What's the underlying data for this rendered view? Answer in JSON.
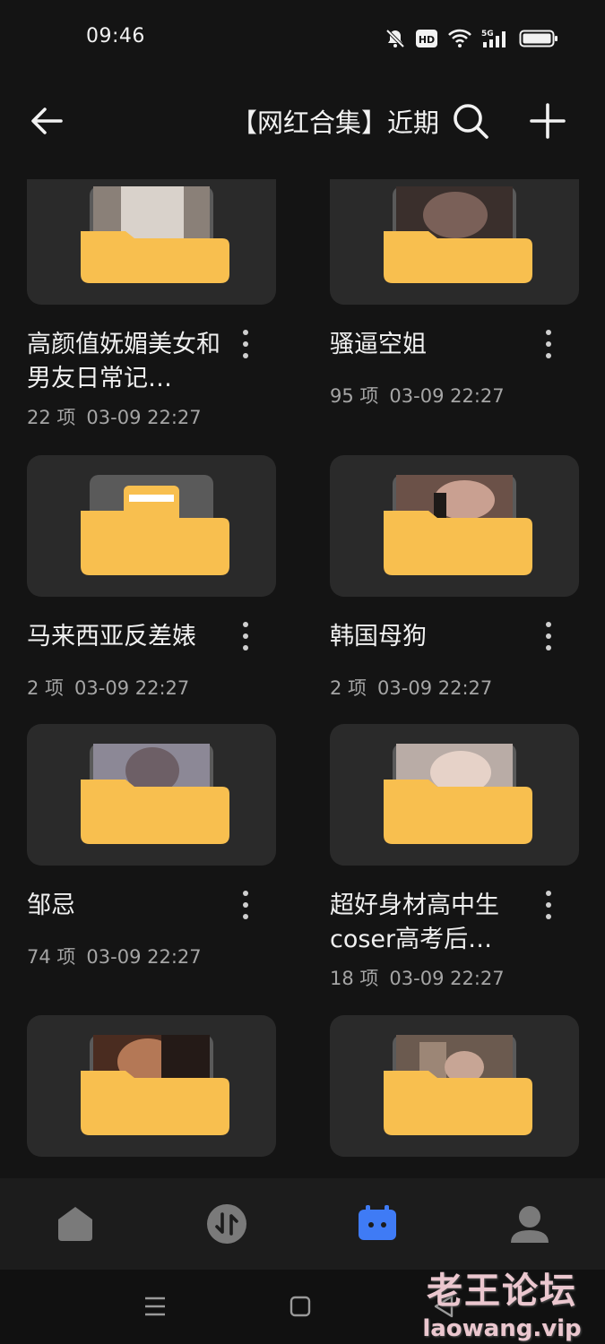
{
  "status_bar": {
    "time": "09:46",
    "icons": [
      "mute-icon",
      "hd-icon",
      "wifi-icon",
      "5g-signal-icon",
      "battery-icon"
    ],
    "hd_label": "HD",
    "network_label": "5G"
  },
  "app_bar": {
    "title": "【网红合集】近期"
  },
  "folders": [
    {
      "name": "高颜值妩媚美女和男友日常记…",
      "count": "22 项",
      "date": "03-09 22:27",
      "preview": "photo"
    },
    {
      "name": "骚逼空姐",
      "count": "95 项",
      "date": "03-09 22:27",
      "preview": "photo"
    },
    {
      "name": "马来西亚反差婊",
      "count": "2 项",
      "date": "03-09 22:27",
      "preview": "empty"
    },
    {
      "name": "韩国母狗",
      "count": "2 项",
      "date": "03-09 22:27",
      "preview": "photo"
    },
    {
      "name": "邹忌",
      "count": "74 项",
      "date": "03-09 22:27",
      "preview": "photo"
    },
    {
      "name": "超好身材高中生coser高考后…",
      "count": "18 项",
      "date": "03-09 22:27",
      "preview": "photo"
    },
    {
      "name": "",
      "count": "",
      "date": "",
      "preview": "photo"
    },
    {
      "name": "",
      "count": "",
      "date": "",
      "preview": "photo"
    }
  ],
  "bottom_nav": {
    "items": [
      "home-icon",
      "transfer-icon",
      "files-icon",
      "profile-icon"
    ],
    "active": "files-icon"
  },
  "watermark": {
    "text_cn": "老王论坛",
    "text_en": "laowang.vip"
  },
  "colors": {
    "background": "#141414",
    "card": "#2a2a2a",
    "folder_yellow": "#f8bf4f",
    "accent_blue": "#3f7bf5",
    "text_secondary": "#a5a5a5"
  }
}
